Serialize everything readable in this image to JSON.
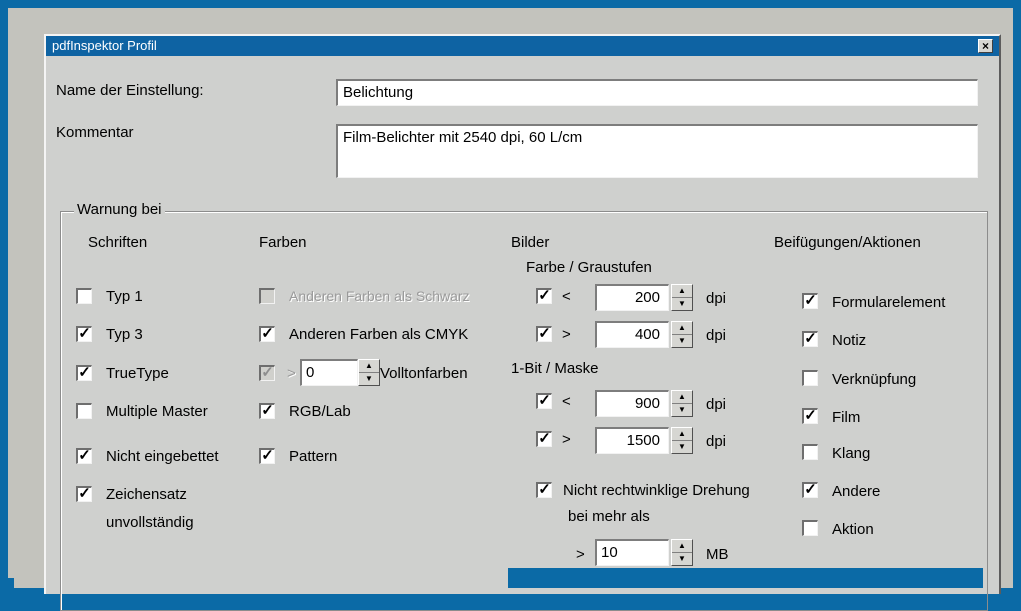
{
  "window": {
    "title": "pdfInspektor Profil"
  },
  "name_label": "Name der Einstellung:",
  "name_value": "Belichtung",
  "comment_label": "Kommentar",
  "comment_value": "Film-Belichter mit 2540 dpi, 60 L/cm",
  "group_label": "Warnung bei",
  "fonts": {
    "header": "Schriften",
    "items": [
      {
        "label": "Typ 1",
        "checked": false
      },
      {
        "label": "Typ 3",
        "checked": true
      },
      {
        "label": "TrueType",
        "checked": true
      },
      {
        "label": "Multiple Master",
        "checked": false
      },
      {
        "label": "Nicht eingebettet",
        "checked": true
      },
      {
        "label": "Zeichensatz",
        "label2": "unvollständig",
        "checked": true
      }
    ]
  },
  "colors": {
    "header": "Farben",
    "items": [
      {
        "label": "Anderen Farben als Schwarz",
        "checked": false,
        "disabled": true
      },
      {
        "label": "Anderen Farben als CMYK",
        "checked": true
      },
      {
        "prefix": ">",
        "value": "0",
        "label": "Volltonfarben",
        "checked": true,
        "disabled": true
      },
      {
        "label": "RGB/Lab",
        "checked": true
      },
      {
        "label": "Pattern",
        "checked": true
      }
    ]
  },
  "images": {
    "header": "Bilder",
    "color_header": "Farbe / Graustufen",
    "bitmask_header": "1-Bit / Maske",
    "unit": "dpi",
    "rows": [
      {
        "op": "<",
        "value": "200",
        "checked": true
      },
      {
        "op": ">",
        "value": "400",
        "checked": true
      },
      {
        "op": "<",
        "value": "900",
        "checked": true
      },
      {
        "op": ">",
        "value": "1500",
        "checked": true
      }
    ],
    "rotation_label": "Nicht rechtwinklige Drehung",
    "rotation_checked": true,
    "more_than_label": "bei mehr als",
    "size_op": ">",
    "size_value": "10",
    "size_unit": "MB"
  },
  "attachments": {
    "header": "Beifügungen/Aktionen",
    "items": [
      {
        "label": "Formularelement",
        "checked": true
      },
      {
        "label": "Notiz",
        "checked": true
      },
      {
        "label": "Verknüpfung",
        "checked": false
      },
      {
        "label": "Film",
        "checked": true
      },
      {
        "label": "Klang",
        "checked": false
      },
      {
        "label": "Andere",
        "checked": true
      },
      {
        "label": "Aktion",
        "checked": false
      }
    ]
  },
  "check_mark": "✓",
  "spin_up": "▲",
  "spin_down": "▼",
  "close_glyph": "×",
  "colors_theme": {
    "title_bar": "#0e63a3",
    "dialog_bg": "#cfd0ce",
    "page_bg": "#0b6aa6"
  }
}
